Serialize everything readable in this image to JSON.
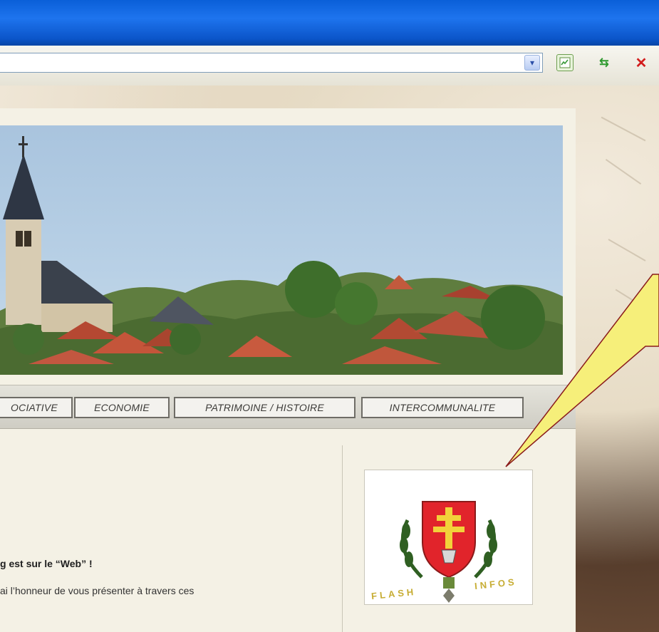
{
  "browser": {
    "address_value": "",
    "icons": [
      "dropdown-arrow-icon",
      "go-page-icon",
      "refresh-icon",
      "stop-icon"
    ]
  },
  "nav": {
    "tabs": [
      {
        "label": "OCIATIVE"
      },
      {
        "label": "ECONOMIE"
      },
      {
        "label": "PATRIMOINE / HISTOIRE"
      },
      {
        "label": "INTERCOMMUNALITE"
      }
    ]
  },
  "content": {
    "headline": "g est sur le “Web” !",
    "intro": "ai l’honneur de vous présenter à travers ces"
  },
  "badge": {
    "left_word": "FLASH",
    "right_word": "INFOS"
  },
  "colors": {
    "title_bar": "#0b5ad4",
    "callout_fill": "#f6ef7a",
    "shield_red": "#e1242b",
    "badge_gold": "#c7ad34"
  }
}
